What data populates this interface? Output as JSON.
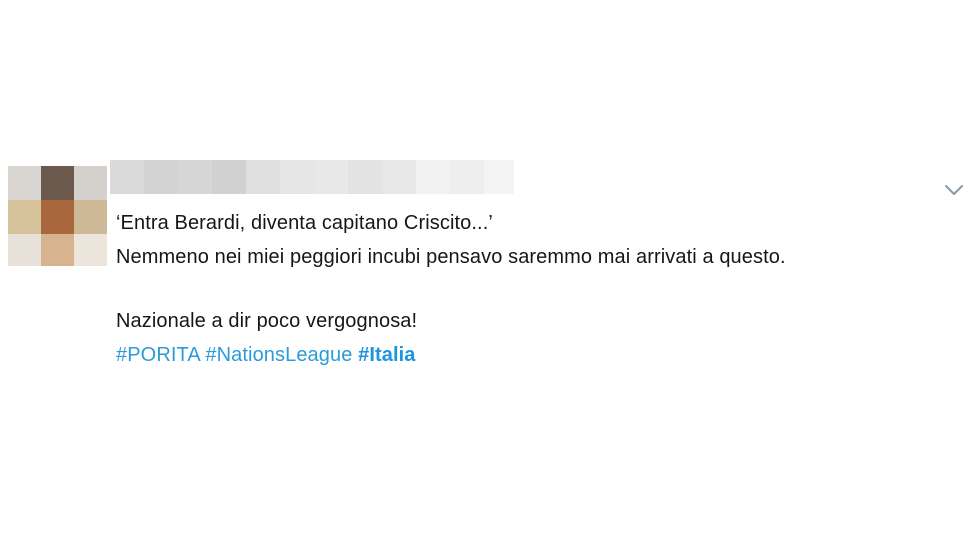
{
  "tweet": {
    "text_line1": "‘Entra Berardi, diventa capitano Criscito...’",
    "text_line2": "Nemmeno nei miei peggiori incubi pensavo saremmo mai arrivati a questo.",
    "text_line3": "Nazionale a dir poco vergognosa!",
    "hashtags": [
      {
        "label": "#PORITA"
      },
      {
        "label": "#NationsLeague"
      },
      {
        "label": "#Italia"
      }
    ],
    "menu_icon": "chevron-down-icon"
  },
  "colors": {
    "hashtag": "#2b9cd8",
    "text": "#14171a",
    "caret": "#8899a6"
  }
}
